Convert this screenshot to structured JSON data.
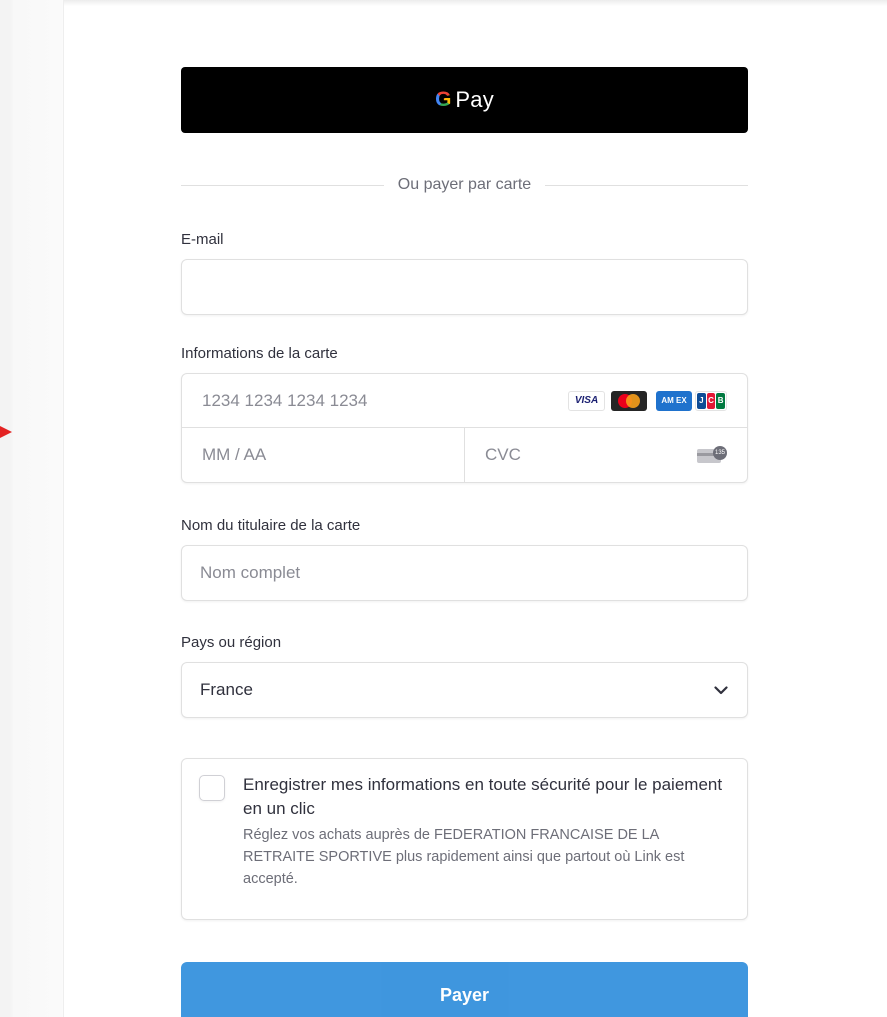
{
  "gpay": {
    "g_letter": "G",
    "label": "Pay"
  },
  "divider": {
    "text": "Ou payer par carte"
  },
  "email": {
    "label": "E-mail",
    "placeholder": ""
  },
  "card": {
    "label": "Informations de la carte",
    "number_placeholder": "1234 1234 1234 1234",
    "expiry_placeholder": "MM / AA",
    "cvc_placeholder": "CVC",
    "brands": [
      "VISA",
      "Mastercard",
      "American Express",
      "JCB"
    ],
    "brand_text": {
      "visa": "VISA",
      "amex": "AM EX",
      "jcb": [
        "J",
        "C",
        "B"
      ]
    },
    "cvc_icon_text": "135"
  },
  "name": {
    "label": "Nom du titulaire de la carte",
    "placeholder": "Nom complet"
  },
  "country": {
    "label": "Pays ou région",
    "value": "France"
  },
  "link": {
    "checked": false,
    "title": "Enregistrer mes informations en toute sécurité pour le paiement en un clic",
    "description": "Réglez vos achats auprès de FEDERATION FRANCAISE DE LA RETRAITE SPORTIVE plus rapidement ainsi que partout où Link est accepté."
  },
  "pay_button": {
    "label": "Payer"
  },
  "colors": {
    "accent": "#0074d4",
    "gpay_background": "#000000",
    "arrow": "#e32222",
    "jcb_blue": "#0e4c96",
    "jcb_red": "#e21836",
    "jcb_green": "#007940"
  }
}
